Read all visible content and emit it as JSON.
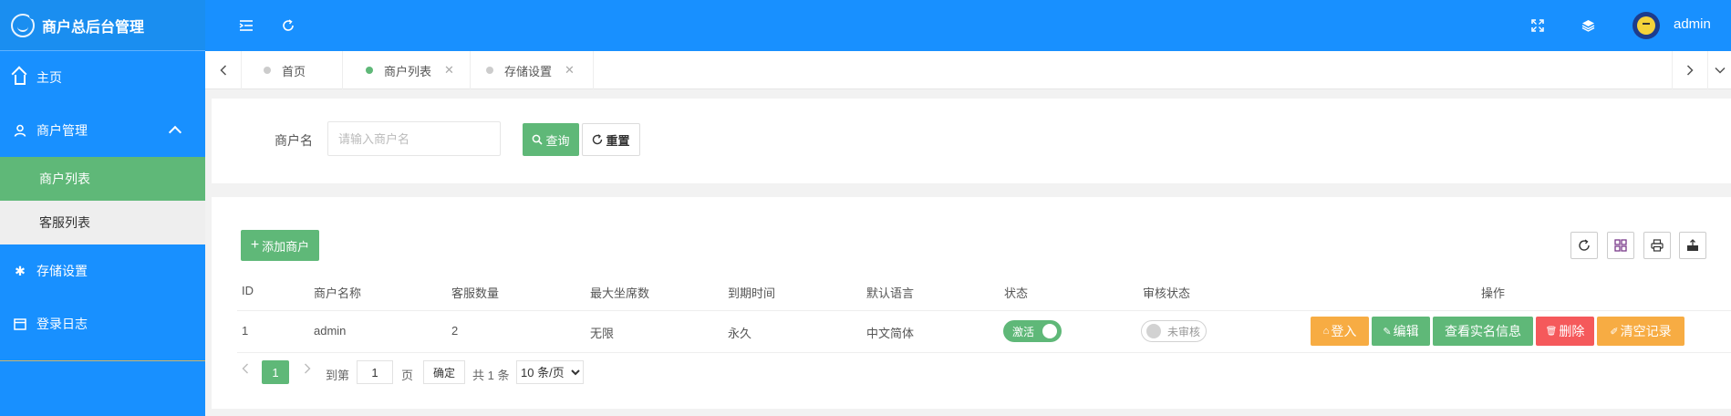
{
  "app": {
    "title": "商户总后台管理"
  },
  "sidebar": {
    "items": [
      {
        "label": "主页",
        "icon": "home-icon"
      },
      {
        "label": "商户管理",
        "icon": "user-icon"
      },
      {
        "label": "存储设置",
        "icon": "gear-icon"
      },
      {
        "label": "登录日志",
        "icon": "calendar-icon"
      }
    ],
    "submenu": [
      {
        "label": "商户列表",
        "active": true
      },
      {
        "label": "客服列表",
        "active": false
      }
    ]
  },
  "header": {
    "username": "admin"
  },
  "tabs": [
    {
      "label": "首页",
      "active": false
    },
    {
      "label": "商户列表",
      "active": true
    },
    {
      "label": "存储设置",
      "active": false
    }
  ],
  "search": {
    "label": "商户名",
    "placeholder": "请输入商户名",
    "query_label": "查询",
    "reset_label": "重置"
  },
  "toolbar": {
    "add_label": "添加商户"
  },
  "table": {
    "headers": [
      "ID",
      "商户名称",
      "客服数量",
      "最大坐席数",
      "到期时间",
      "默认语言",
      "状态",
      "审核状态",
      "操作"
    ],
    "rows": [
      {
        "id": "1",
        "name": "admin",
        "agents": "2",
        "max_seats": "无限",
        "expiry": "永久",
        "language": "中文简体",
        "status": "激活",
        "review": "未审核"
      }
    ],
    "actions": [
      "登入",
      "编辑",
      "查看实名信息",
      "删除",
      "清空记录"
    ]
  },
  "pagination": {
    "current_page": "1",
    "goto_label": "到第",
    "goto_value": "1",
    "page_unit": "页",
    "confirm_label": "确定",
    "total_label": "共 1 条",
    "page_size_option": "10 条/页"
  },
  "colors": {
    "primary": "#1890ff",
    "green": "#5fb878",
    "orange": "#f7ac43",
    "red": "#f5595b"
  }
}
